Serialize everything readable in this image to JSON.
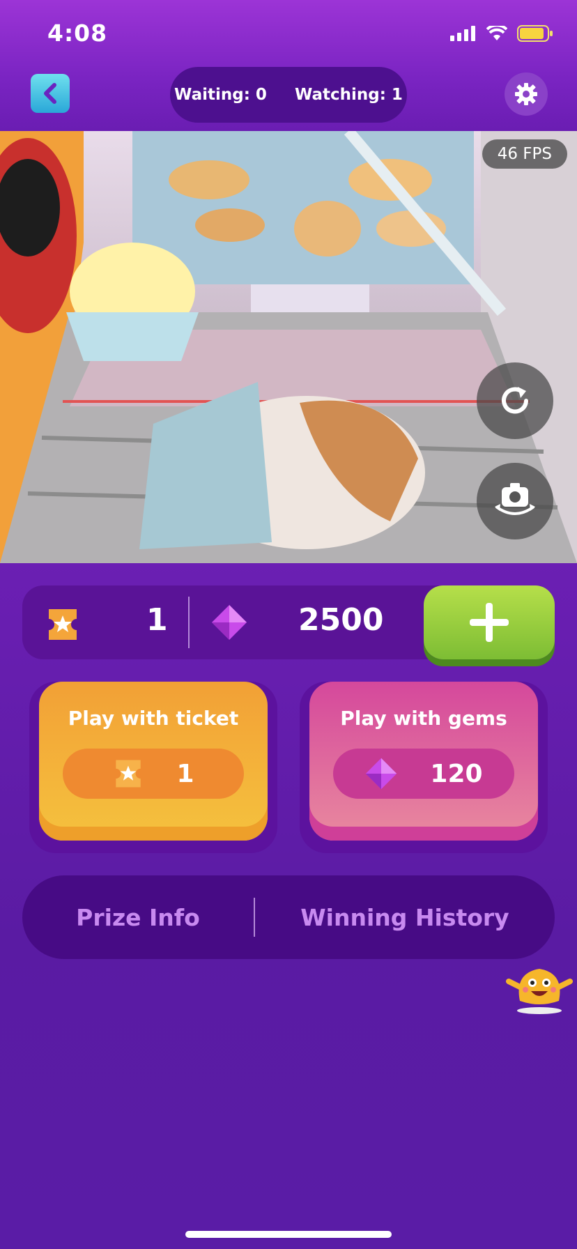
{
  "status_bar": {
    "time": "4:08"
  },
  "header": {
    "waiting_label": "Waiting: 0",
    "watching_label": "Watching: 1"
  },
  "camera": {
    "fps_label": "46 FPS"
  },
  "wallet": {
    "tickets": "1",
    "gems": "2500"
  },
  "play_ticket": {
    "title": "Play with ticket",
    "cost": "1"
  },
  "play_gems": {
    "title": "Play with gems",
    "cost": "120"
  },
  "info_tabs": {
    "prize_info": "Prize Info",
    "winning_history": "Winning History"
  },
  "colors": {
    "accent_purple": "#6b1fb3",
    "ticket_orange": "#f2a036",
    "gem_pink": "#d5489c",
    "add_green": "#7dbd34",
    "back_cyan": "#2aa7d8"
  },
  "icons": [
    "back-icon",
    "gear-icon",
    "refresh-icon",
    "camera-switch-icon",
    "ticket-icon",
    "gem-icon",
    "plus-icon",
    "mascot-icon"
  ]
}
